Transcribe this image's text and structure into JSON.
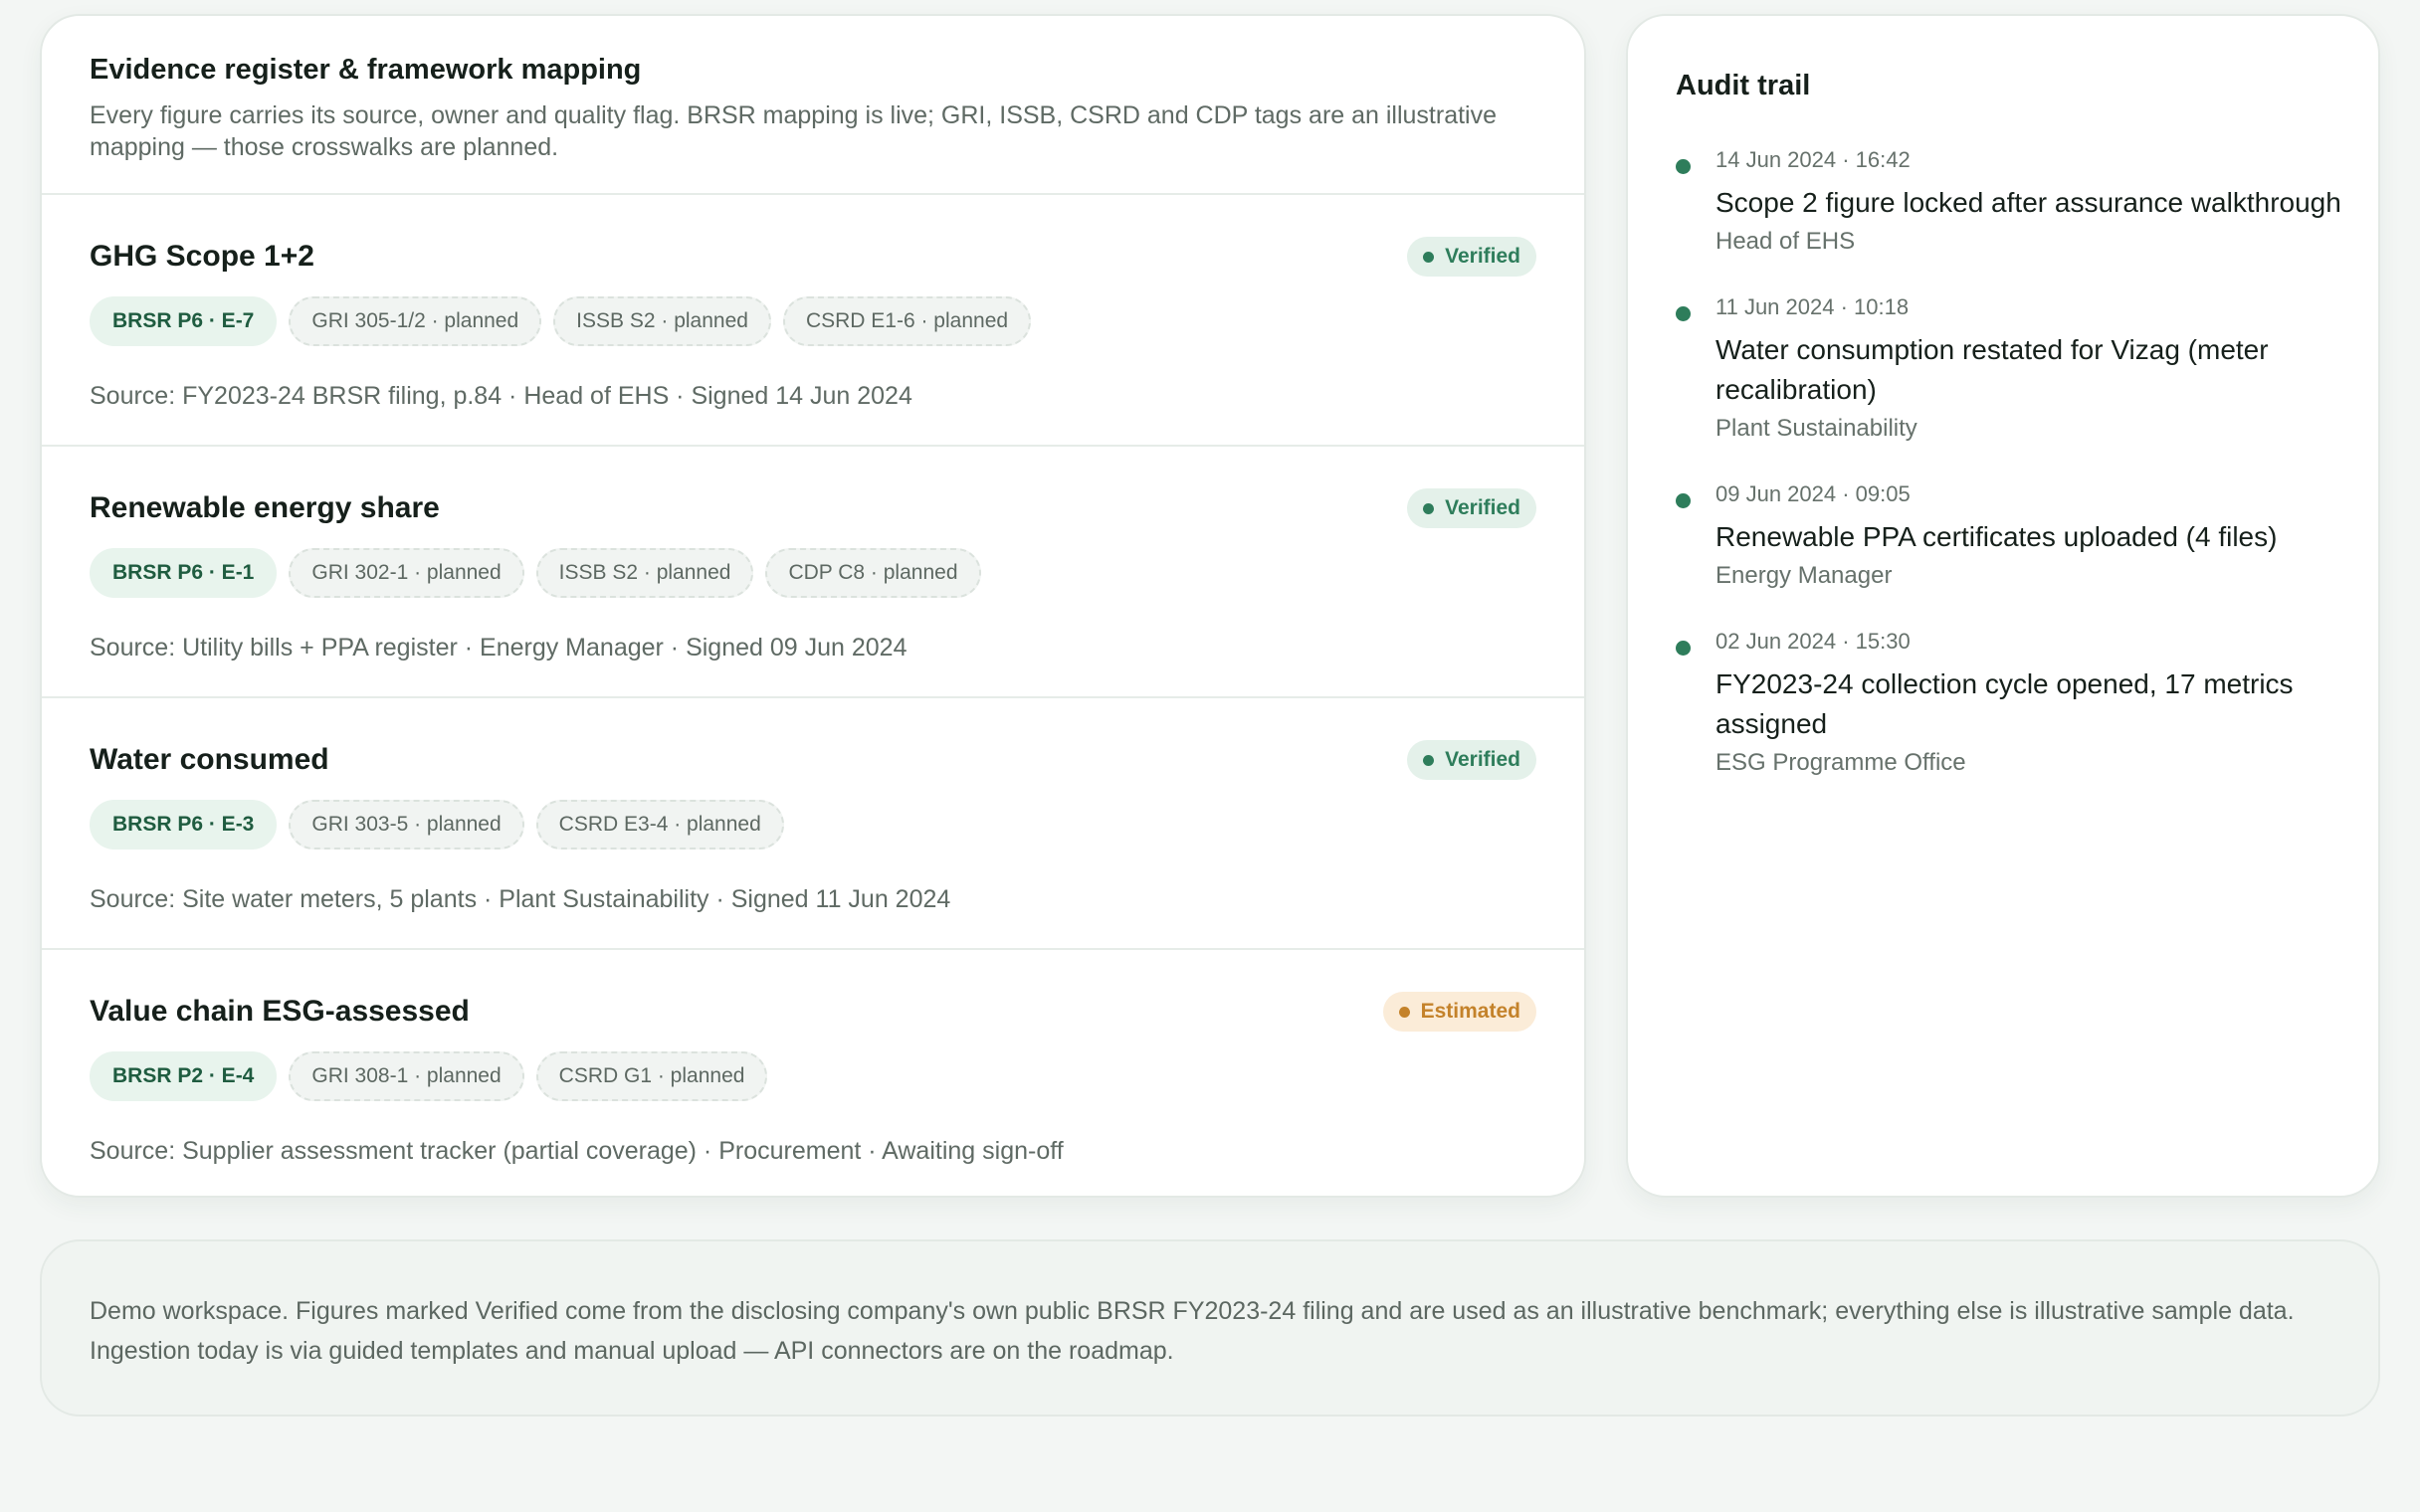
{
  "evidence": {
    "title": "Evidence register & framework mapping",
    "description": "Every figure carries its source, owner and quality flag. BRSR mapping is live; GRI, ISSB, CSRD and CDP tags are an illustrative mapping — those crosswalks are planned.",
    "metrics": [
      {
        "name": "GHG Scope 1+2",
        "status": "Verified",
        "tags": [
          "BRSR P6 · E-7",
          "GRI 305-1/2 · planned",
          "ISSB S2 · planned",
          "CSRD E1-6 · planned"
        ],
        "source": "Source: FY2023-24 BRSR filing, p.84 · Head of EHS · Signed 14 Jun 2024"
      },
      {
        "name": "Renewable energy share",
        "status": "Verified",
        "tags": [
          "BRSR P6 · E-1",
          "GRI 302-1 · planned",
          "ISSB S2 · planned",
          "CDP C8 · planned"
        ],
        "source": "Source: Utility bills + PPA register · Energy Manager · Signed 09 Jun 2024"
      },
      {
        "name": "Water consumed",
        "status": "Verified",
        "tags": [
          "BRSR P6 · E-3",
          "GRI 303-5 · planned",
          "CSRD E3-4 · planned"
        ],
        "source": "Source: Site water meters, 5 plants · Plant Sustainability · Signed 11 Jun 2024"
      },
      {
        "name": "Value chain ESG-assessed",
        "status": "Estimated",
        "tags": [
          "BRSR P2 · E-4",
          "GRI 308-1 · planned",
          "CSRD G1 · planned"
        ],
        "source": "Source: Supplier assessment tracker (partial coverage) · Procurement · Awaiting sign-off"
      }
    ]
  },
  "audit": {
    "title": "Audit trail",
    "items": [
      {
        "time": "14 Jun 2024 · 16:42",
        "text": "Scope 2 figure locked after assurance walkthrough",
        "who": "Head of EHS"
      },
      {
        "time": "11 Jun 2024 · 10:18",
        "text": "Water consumption restated for Vizag (meter recalibration)",
        "who": "Plant Sustainability"
      },
      {
        "time": "09 Jun 2024 · 09:05",
        "text": "Renewable PPA certificates uploaded (4 files)",
        "who": "Energy Manager"
      },
      {
        "time": "02 Jun 2024 · 15:30",
        "text": "FY2023-24 collection cycle opened, 17 metrics assigned",
        "who": "ESG Programme Office"
      }
    ]
  },
  "footer": {
    "note": "Demo workspace. Figures marked Verified come from the disclosing company's own public BRSR FY2023-24 filing and are used as an illustrative benchmark; everything else is illustrative sample data. Ingestion today is via guided templates and manual upload — API connectors are on the roadmap."
  },
  "colors": {
    "accent": "#2e7d5b",
    "verified_bg": "#e4f1ea",
    "estimated": "#c4822a",
    "estimated_bg": "#fbecd8",
    "page_bg": "#f3f6f4"
  }
}
